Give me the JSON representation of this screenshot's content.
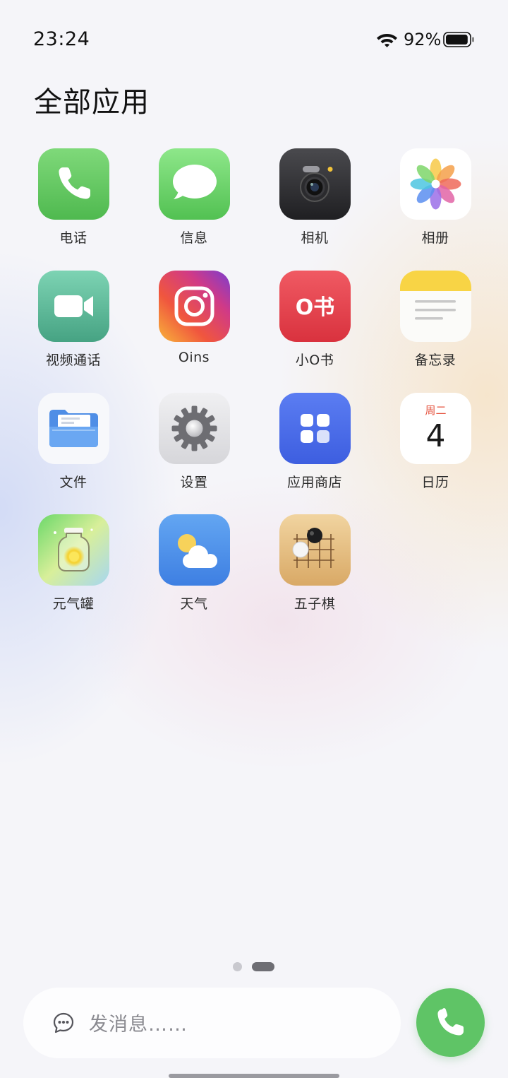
{
  "status_bar": {
    "time": "23:24",
    "battery_percent": "92%",
    "battery_level": 0.92
  },
  "page": {
    "title": "全部应用"
  },
  "apps": [
    {
      "label": "电话",
      "icon": "phone-icon"
    },
    {
      "label": "信息",
      "icon": "message-bubble-icon"
    },
    {
      "label": "相机",
      "icon": "camera-icon"
    },
    {
      "label": "相册",
      "icon": "photos-flower-icon"
    },
    {
      "label": "视频通话",
      "icon": "video-camera-icon"
    },
    {
      "label": "Oins",
      "icon": "instagram-camera-icon"
    },
    {
      "label": "小O书",
      "icon": "xiaoo-book-icon",
      "icon_text": "O书"
    },
    {
      "label": "备忘录",
      "icon": "notes-icon"
    },
    {
      "label": "文件",
      "icon": "folder-icon"
    },
    {
      "label": "设置",
      "icon": "gear-icon"
    },
    {
      "label": "应用商店",
      "icon": "app-store-grid-icon"
    },
    {
      "label": "日历",
      "icon": "calendar-icon",
      "weekday": "周二",
      "day": "4"
    },
    {
      "label": "元气罐",
      "icon": "energy-jar-icon"
    },
    {
      "label": "天气",
      "icon": "weather-sun-cloud-icon"
    },
    {
      "label": "五子棋",
      "icon": "gomoku-board-icon"
    }
  ],
  "pager": {
    "pages": 2,
    "current": 2
  },
  "dock": {
    "message_placeholder": "发消息……"
  },
  "colors": {
    "phone_green": "#5fc466",
    "calendar_red": "#e5533f"
  }
}
